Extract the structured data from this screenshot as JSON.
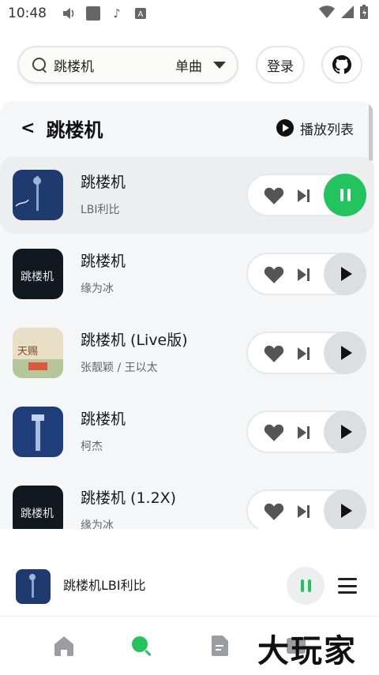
{
  "status_bar": {
    "time": "10:48"
  },
  "search": {
    "query": "跳楼机",
    "type": "单曲"
  },
  "header_actions": {
    "login": "登录"
  },
  "panel": {
    "title": "跳楼机",
    "playlist_label": "播放列表"
  },
  "songs": [
    {
      "title": "跳楼机",
      "artist": "LBI利比",
      "playing": true
    },
    {
      "title": "跳楼机",
      "artist": "缘为冰",
      "playing": false
    },
    {
      "title": "跳楼机 (Live版)",
      "artist": "张靓颖 / 王以太",
      "playing": false
    },
    {
      "title": "跳楼机",
      "artist": "柯杰",
      "playing": false
    },
    {
      "title": "跳楼机 (1.2X)",
      "artist": "缘为冰",
      "playing": false
    }
  ],
  "mini_player": {
    "text": "跳楼机LBI利比"
  },
  "nav": {
    "items": [
      "home-icon",
      "search-icon",
      "document-icon",
      "profile-icon"
    ]
  },
  "watermark": "大玩家",
  "colors": {
    "accent": "#23c35d",
    "panel_bg": "#f4f6f8"
  }
}
